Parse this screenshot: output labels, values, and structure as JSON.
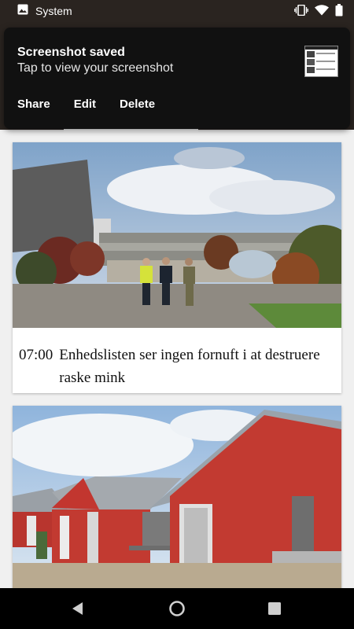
{
  "status_bar": {
    "app_label": "System",
    "icons": [
      "image-icon",
      "vibrate-icon",
      "wifi-icon",
      "battery-icon"
    ]
  },
  "notification": {
    "title": "Screenshot saved",
    "subtitle": "Tap to view your screenshot",
    "actions": {
      "share": "Share",
      "edit": "Edit",
      "delete": "Delete"
    }
  },
  "articles": [
    {
      "time": "07:00",
      "title": "Enhedslisten ser ingen fornuft i at destruere raske mink"
    }
  ],
  "colors": {
    "notification_bg": "#111111",
    "header_bg": "#2a2420",
    "feed_bg": "#f0f0f0",
    "card_bg": "#ffffff",
    "barn_red": "#c23a31"
  },
  "nav_bar": {
    "icons": [
      "back-icon",
      "home-icon",
      "recents-icon"
    ]
  }
}
